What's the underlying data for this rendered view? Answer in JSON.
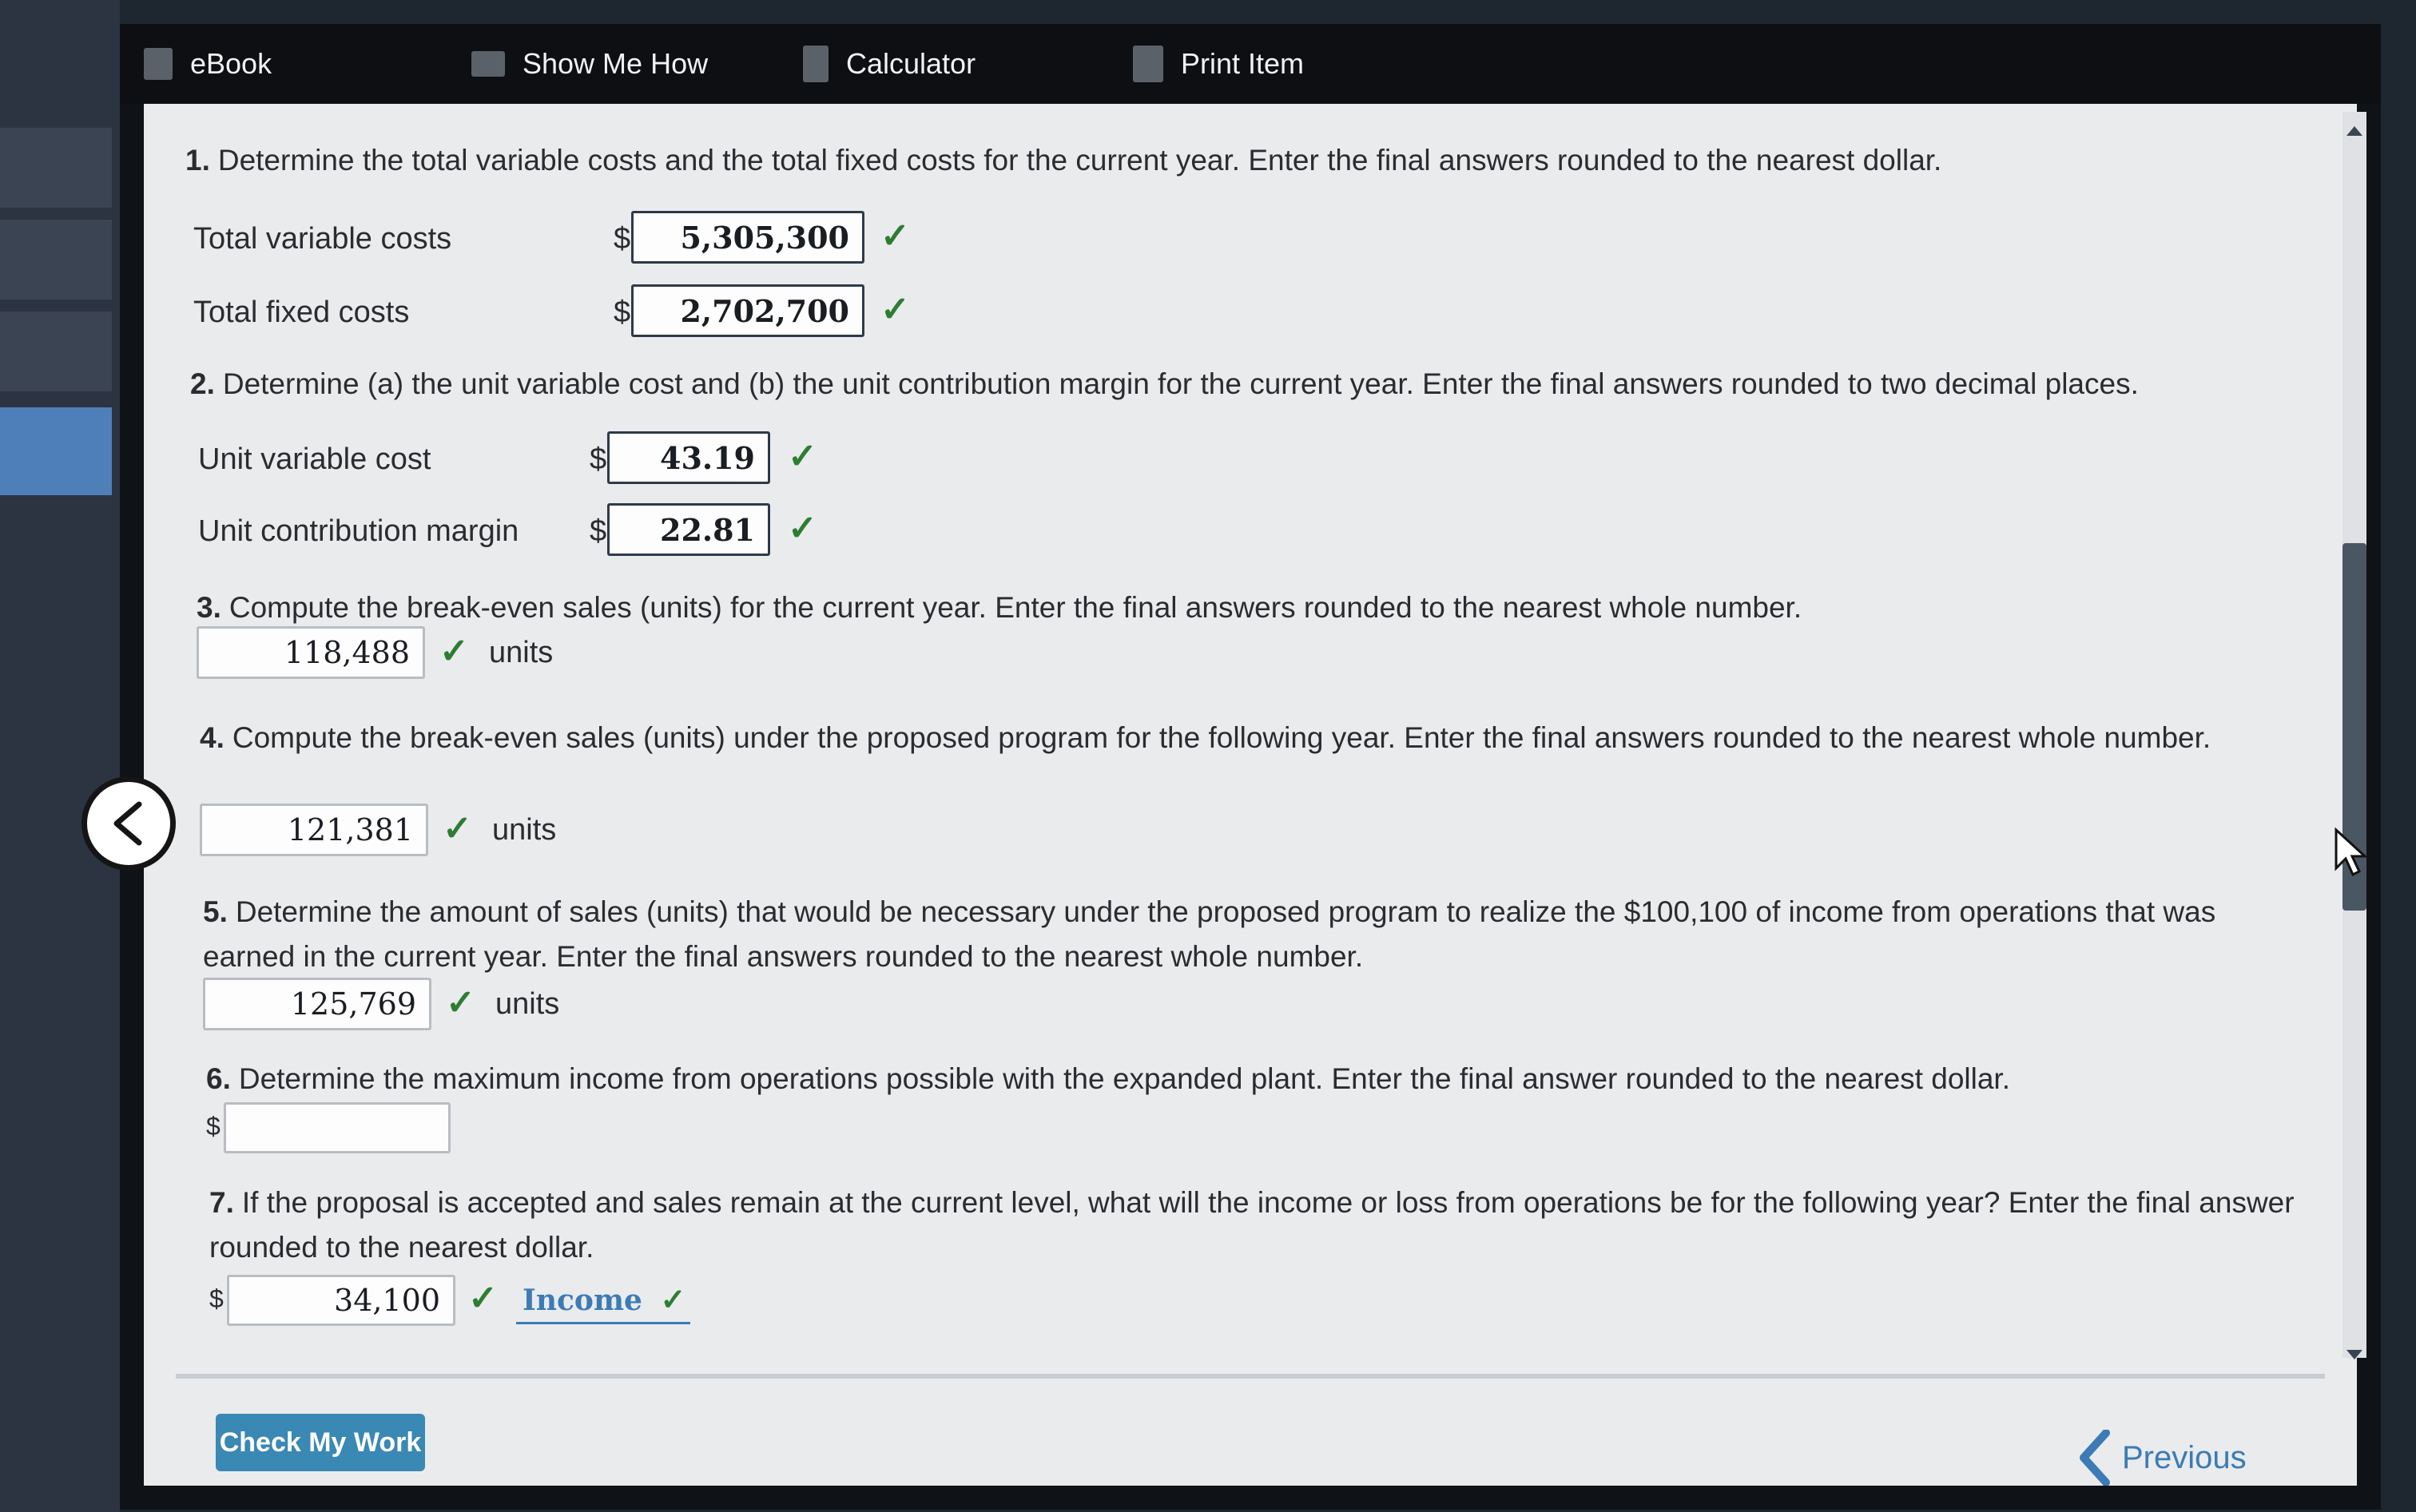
{
  "toolbar": {
    "items": [
      {
        "label": "eBook",
        "icon": "book-icon"
      },
      {
        "label": "Show Me How",
        "icon": "video-icon"
      },
      {
        "label": "Calculator",
        "icon": "calculator-icon"
      },
      {
        "label": "Print Item",
        "icon": "print-icon"
      }
    ]
  },
  "questions": {
    "q1": {
      "number": "1.",
      "text": "Determine the total variable costs and the total fixed costs for the current year. Enter the final answers rounded to the nearest dollar.",
      "rows": [
        {
          "label": "Total variable costs",
          "currency": "$",
          "value": "5,305,300"
        },
        {
          "label": "Total fixed costs",
          "currency": "$",
          "value": "2,702,700"
        }
      ]
    },
    "q2": {
      "number": "2.",
      "text": "Determine (a) the unit variable cost and (b) the unit contribution margin for the current year. Enter the final answers rounded to two decimal places.",
      "rows": [
        {
          "label": "Unit variable cost",
          "currency": "$",
          "value": "43.19"
        },
        {
          "label": "Unit contribution margin",
          "currency": "$",
          "value": "22.81"
        }
      ]
    },
    "q3": {
      "number": "3.",
      "text": "Compute the break-even sales (units) for the current year. Enter the final answers rounded to the nearest whole number.",
      "value": "118,488",
      "unit": "units"
    },
    "q4": {
      "number": "4.",
      "text": "Compute the break-even sales (units) under the proposed program for the following year. Enter the final answers rounded to the nearest whole number.",
      "value": "121,381",
      "unit": "units"
    },
    "q5": {
      "number": "5.",
      "text": "Determine the amount of sales (units) that would be necessary under the proposed program to realize the $100,100 of income from operations that was earned in the current year. Enter the final answers rounded to the nearest whole number.",
      "value": "125,769",
      "unit": "units"
    },
    "q6": {
      "number": "6.",
      "text": "Determine the maximum income from operations possible with the expanded plant. Enter the final answer rounded to the nearest dollar.",
      "currency": "$",
      "value": ""
    },
    "q7": {
      "number": "7.",
      "text": "If the proposal is accepted and sales remain at the current level, what will the income or loss from operations be for the following year? Enter the final answer rounded to the nearest dollar.",
      "currency": "$",
      "value": "34,100",
      "selection": "Income"
    }
  },
  "footer": {
    "check_button": "Check My Work",
    "previous": "Previous"
  },
  "colors": {
    "check_green": "#2e7d32",
    "link_blue": "#3c7bb5",
    "button_blue": "#3a88b4"
  }
}
